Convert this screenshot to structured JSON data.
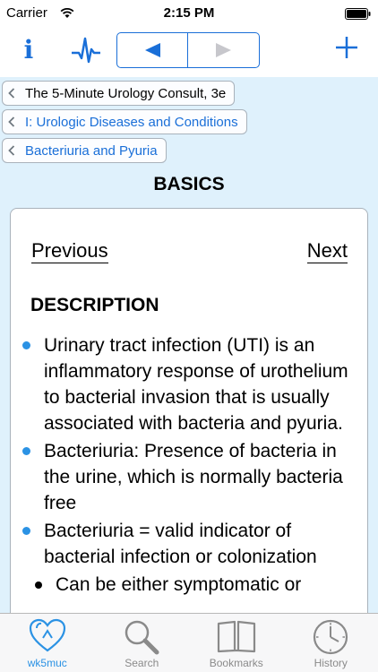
{
  "status_bar": {
    "carrier": "Carrier",
    "time": "2:15 PM"
  },
  "toolbar": {
    "info_icon": "info-icon",
    "pulse_icon": "pulse-icon",
    "back_icon": "back-arrow-icon",
    "forward_icon": "forward-arrow-icon",
    "add_icon": "plus-icon",
    "accent_color": "#1a6fd8"
  },
  "breadcrumbs": [
    {
      "label": "The 5-Minute Urology Consult, 3e"
    },
    {
      "label": "I: Urologic Diseases and Conditions"
    },
    {
      "label": "Bacteriuria and Pyuria"
    }
  ],
  "section_title": "BASICS",
  "card": {
    "previous_label": "Previous",
    "next_label": "Next",
    "heading": "DESCRIPTION",
    "bullets": [
      "Urinary tract infection (UTI) is an inflammatory response of urothelium to bacterial invasion that is usually associated with bacteria and pyuria.",
      "Bacteriuria: Presence of bacteria in the urine, which is normally bacteria free",
      "Bacteriuria = valid indicator of bacterial infection or colonization"
    ],
    "sub_bullet": "Can be either symptomatic or"
  },
  "tabs": [
    {
      "label": "wk5muc",
      "icon": "heart-icon",
      "active": true
    },
    {
      "label": "Search",
      "icon": "magnifier-icon",
      "active": false
    },
    {
      "label": "Bookmarks",
      "icon": "book-icon",
      "active": false
    },
    {
      "label": "History",
      "icon": "clock-icon",
      "active": false
    }
  ],
  "colors": {
    "content_background": "#dff1fc",
    "bullet_color": "#2b92e4"
  }
}
